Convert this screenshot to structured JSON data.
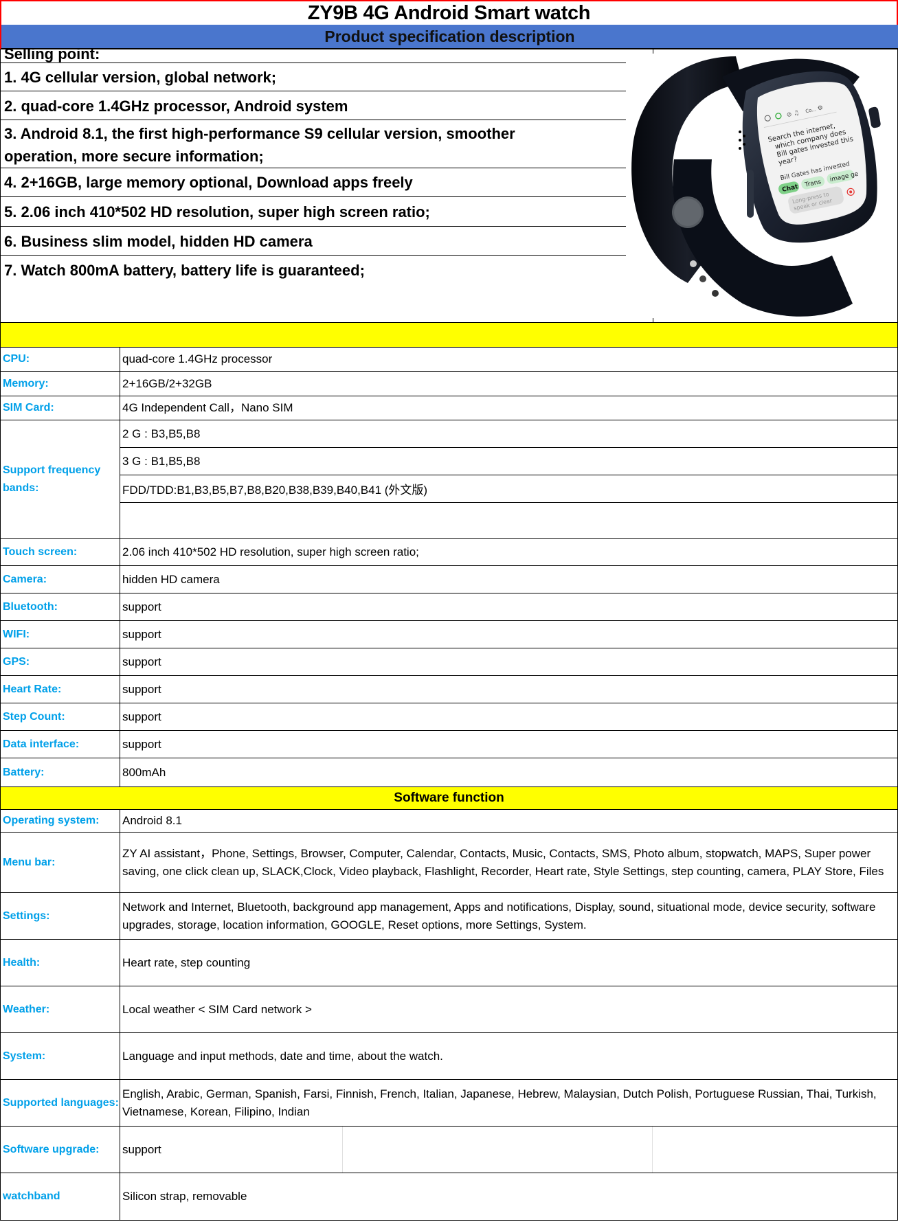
{
  "header": {
    "title": "ZY9B 4G Android  Smart watch",
    "subtitle": "Product specification description"
  },
  "selling_points": {
    "heading": "Selling point:",
    "items": [
      "1. 4G cellular version, global network;",
      "2. quad-core 1.4GHz processor, Android  system",
      "3. Android 8.1, the first high-performance S9 cellular version, smoother operation, more secure information;",
      "4. 2+16GB,  large memory optional, Download apps freely",
      "5. 2.06 inch 410*502  HD resolution, super high screen ratio;",
      "6. Business slim model, hidden HD camera",
      "7. Watch 800mA battery, battery life is guaranteed;"
    ]
  },
  "product_image": {
    "icon": "smartwatch-image",
    "screen": {
      "question": "Search the internet, which company does Bill gates invested this year?",
      "answer_preview": "Bill Gates has invested",
      "chips": [
        "Chat",
        "Trans",
        "image ge"
      ],
      "input_placeholder": "Long-press to speak or clear",
      "top_icons": [
        "add-icon",
        "chat-icon",
        "mute-icon",
        "headphones-icon",
        "Co...",
        "settings-icon"
      ]
    }
  },
  "hardware": {
    "section_label": "",
    "rows": [
      {
        "label": "CPU:",
        "value": "quad-core 1.4GHz processor"
      },
      {
        "label": "Memory:",
        "value": "2+16GB/2+32GB"
      },
      {
        "label": "SIM Card:",
        "value": "4G Independent Call，Nano SIM"
      },
      {
        "label": "Support frequency bands:",
        "values": [
          "2  G : B3,B5,B8",
          "3  G : B1,B5,B8",
          "FDD/TDD:B1,B3,B5,B7,B8,B20,B38,B39,B40,B41    (外文版)",
          ""
        ]
      },
      {
        "label": "Touch screen:",
        "value": " 2.06 inch 410*502  HD resolution, super high screen ratio;"
      },
      {
        "label": "Camera:",
        "value": "hidden HD camera"
      },
      {
        "label": "Bluetooth:",
        "value": "support"
      },
      {
        "label": "WIFI:",
        "value": "support"
      },
      {
        "label": "GPS:",
        "value": "support"
      },
      {
        "label": "Heart Rate:",
        "value": "support"
      },
      {
        "label": "Step Count:",
        "value": "support"
      },
      {
        "label": "Data interface:",
        "value": "support"
      },
      {
        "label": "Battery:",
        "value": " 800mAh"
      }
    ]
  },
  "software": {
    "section_label": "Software function",
    "rows": [
      {
        "label": "Operating system:",
        "value": "Android 8.1"
      },
      {
        "label": "Menu bar:",
        "value": "ZY AI assistant，Phone, Settings, Browser, Computer, Calendar, Contacts, Music, Contacts, SMS, Photo album, stopwatch, MAPS, Super power saving, one click clean up, SLACK,Clock, Video playback, Flashlight, Recorder, Heart rate, Style Settings, step counting, camera, PLAY Store, Files"
      },
      {
        "label": "Settings:",
        "value": "Network and Internet, Bluetooth, background app management, Apps and notifications, Display, sound, situational mode, device security, software upgrades, storage, location information, GOOGLE, Reset options, more Settings, System."
      },
      {
        "label": "Health:",
        "value": "Heart rate, step counting"
      },
      {
        "label": "Weather:",
        "value": "Local weather < SIM Card network >"
      },
      {
        "label": "System:",
        "value": "Language and input methods, date and time, about the watch."
      },
      {
        "label": "Supported languages:",
        "value": "English, Arabic, German, Spanish, Farsi, Finnish, French, Italian, Japanese, Hebrew, Malaysian, Dutch Polish, Portuguese Russian, Thai, Turkish, Vietnamese, Korean, Filipino, Indian"
      },
      {
        "label": "Software upgrade:",
        "value": "support"
      },
      {
        "label": "watchband",
        "value": "Silicon strap, removable"
      }
    ]
  },
  "colors": {
    "title_border": "#ff0000",
    "header_bar": "#4a76cd",
    "section_bar": "#ffff00",
    "label_text": "#00a0e9"
  }
}
